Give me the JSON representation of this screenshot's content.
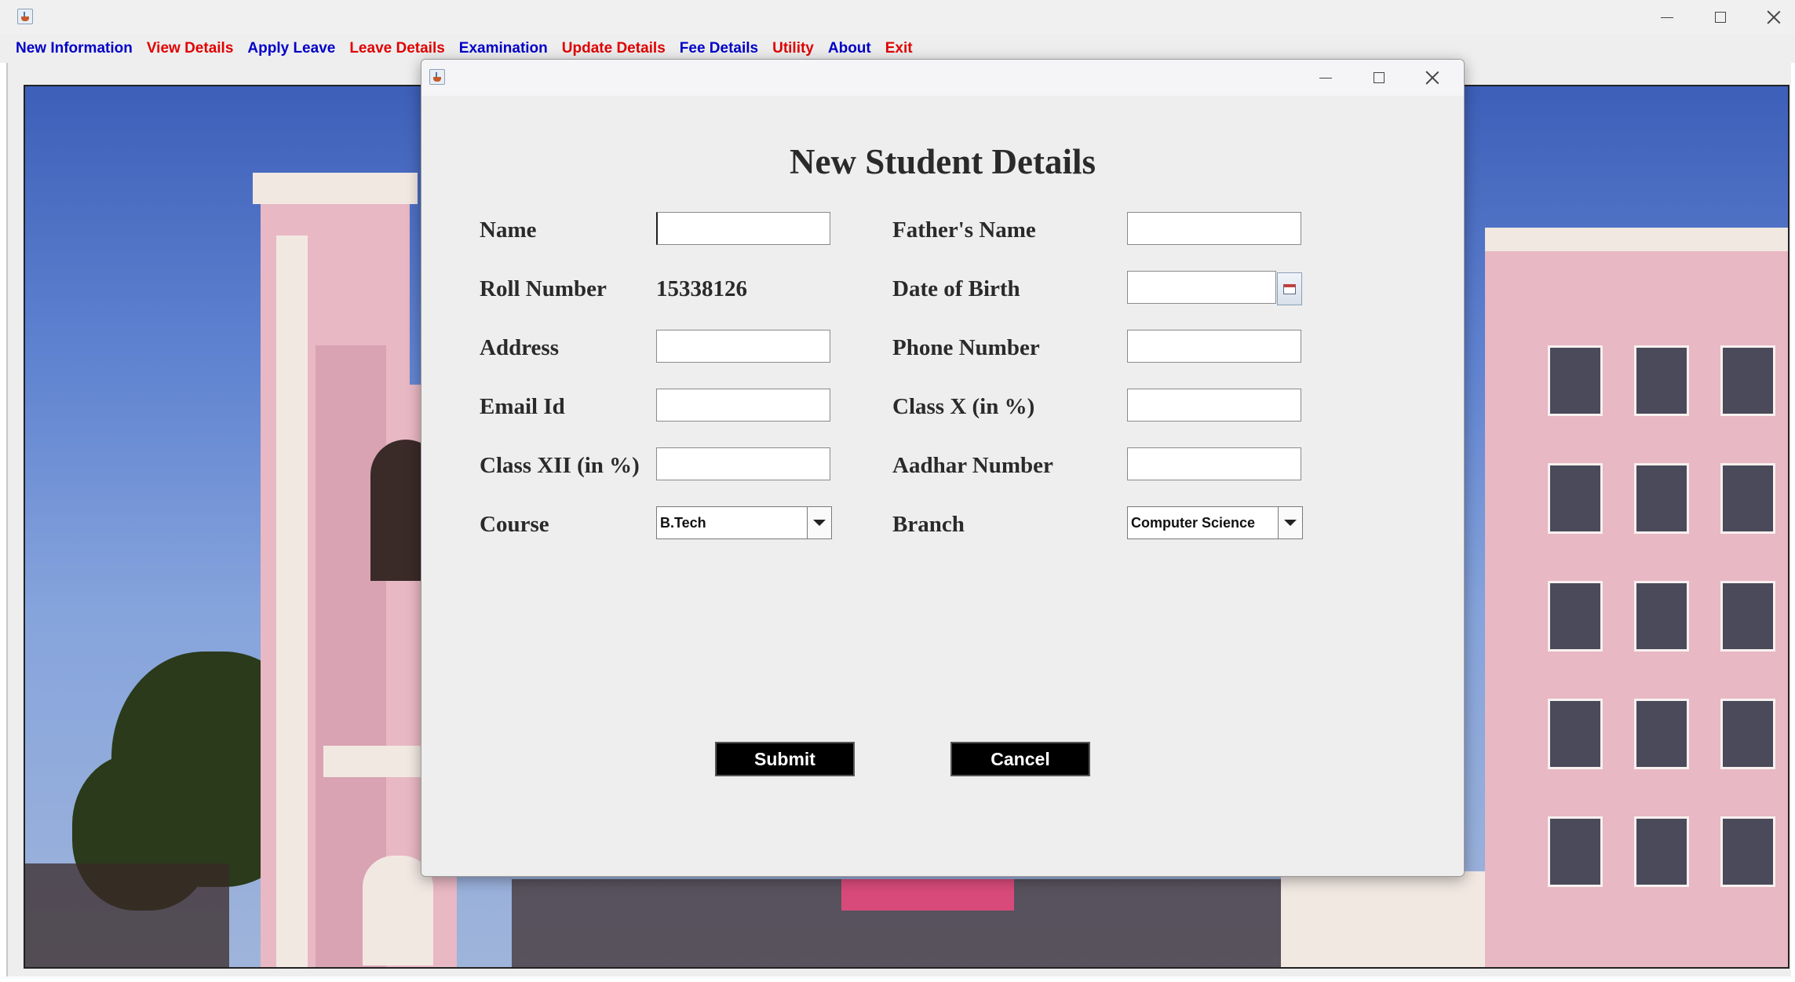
{
  "menubar": {
    "items": [
      {
        "label": "New Information",
        "color": "#0000c8"
      },
      {
        "label": "View Details",
        "color": "#e00000"
      },
      {
        "label": "Apply Leave",
        "color": "#0000c8"
      },
      {
        "label": "Leave Details",
        "color": "#e00000"
      },
      {
        "label": "Examination",
        "color": "#0000c8"
      },
      {
        "label": "Update Details",
        "color": "#e00000"
      },
      {
        "label": "Fee Details",
        "color": "#0000c8"
      },
      {
        "label": "Utility",
        "color": "#e00000"
      },
      {
        "label": "About",
        "color": "#0000c8"
      },
      {
        "label": "Exit",
        "color": "#e00000"
      }
    ]
  },
  "form": {
    "title": "New Student Details",
    "labels": {
      "name": "Name",
      "fathers_name": "Father's Name",
      "roll_number": "Roll Number",
      "date_of_birth": "Date of Birth",
      "address": "Address",
      "phone_number": "Phone Number",
      "email_id": "Email Id",
      "class_x": "Class X (in %)",
      "class_xii": "Class XII (in %)",
      "aadhar_number": "Aadhar Number",
      "course": "Course",
      "branch": "Branch"
    },
    "values": {
      "name": "",
      "fathers_name": "",
      "roll_number": "15338126",
      "date_of_birth": "",
      "address": "",
      "phone_number": "",
      "email_id": "",
      "class_x": "",
      "class_xii": "",
      "aadhar_number": "",
      "course": "B.Tech",
      "branch": "Computer Science"
    },
    "buttons": {
      "submit": "Submit",
      "cancel": "Cancel"
    }
  },
  "icons": {
    "app": "java-app-icon",
    "calendar": "calendar-icon",
    "dropdown": "chevron-down-icon"
  }
}
